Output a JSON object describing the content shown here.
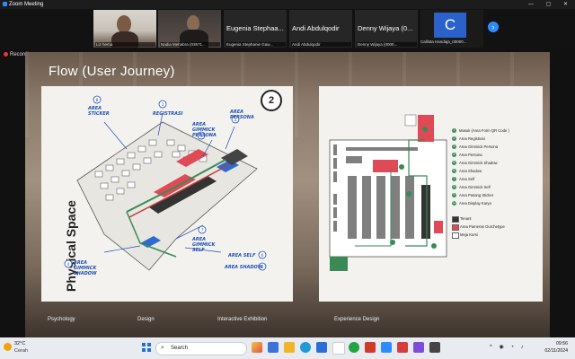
{
  "window": {
    "title": "Zoom Meeting"
  },
  "participants": [
    {
      "name": "",
      "label": "Liz hema",
      "video": true
    },
    {
      "name": "",
      "label": "Nadia Mehabra (03571...",
      "video": true
    },
    {
      "name": "Eugenia  Stephaa...",
      "label": "Eugenia Stephanie Gaw...",
      "video": false
    },
    {
      "name": "Andi  Abdulqodir",
      "label": "Andi Abdulqodir",
      "video": false
    },
    {
      "name": "Denny  Wijaya (0...",
      "label": "Denny Wijaya (0000...",
      "video": false
    },
    {
      "name": "C",
      "label": "Callista Handaja_00000...",
      "video": false
    }
  ],
  "recording": "Recording",
  "slide": {
    "title": "Flow (User Journey)",
    "vertical_label": "Physical Space",
    "badge": "2",
    "handwritten_notes": [
      "AREA STICKER",
      "REGISTRASI",
      "AREA GIMMICK PERSONA",
      "AREA PERSONA",
      "AREA GIMMICK SELF",
      "AREA GIMMICK SHADOW",
      "AREA SELF",
      "AREA SHADOW"
    ],
    "note_numbers": [
      "8",
      "1",
      "3",
      "2",
      "7",
      "4",
      "6",
      "5"
    ],
    "legend": [
      {
        "n": "1",
        "text": "Masuk (Area Form QR Code )"
      },
      {
        "n": "2",
        "text": "Area Registrasi"
      },
      {
        "n": "3",
        "text": "Area Gimmick Persona"
      },
      {
        "n": "4",
        "text": "Area Persona"
      },
      {
        "n": "5",
        "text": "Area Gimmick Shadow"
      },
      {
        "n": "6",
        "text": "Area Shadow"
      },
      {
        "n": "7",
        "text": "Area Self"
      },
      {
        "n": "8",
        "text": "Area Gimmick Self"
      },
      {
        "n": "9",
        "text": "Area Pasang Sticker"
      },
      {
        "n": "10",
        "text": "Area Display Karya"
      }
    ],
    "key": [
      {
        "text": "Tenant",
        "color": "#333333"
      },
      {
        "text": "Area Pameran Ourchetype",
        "color": "#e04a57"
      },
      {
        "text": "Meja Kursi",
        "color": "#ffffff"
      }
    ],
    "footer": [
      "Psychology",
      "Design",
      "Interactive Exhibition",
      "Experience Design"
    ]
  },
  "taskbar": {
    "temp": "32°C",
    "condition": "Cerah",
    "search_placeholder": "Search",
    "time": "09:56",
    "date": "02/11/2024"
  },
  "colors": {
    "zoom_blue": "#2d8cff",
    "accent_red": "#e04a57",
    "route_green": "#3a8a55",
    "ink_blue": "#1f4fb8"
  }
}
